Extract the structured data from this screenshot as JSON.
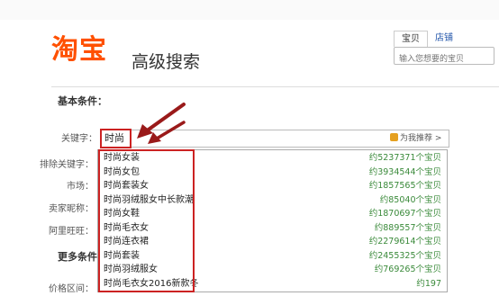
{
  "header": {
    "logo_text": "淘宝",
    "subtitle": "高级搜索",
    "tabs": [
      {
        "label": "宝贝"
      },
      {
        "label": "店铺"
      }
    ],
    "search_placeholder": "输入您想要的宝贝"
  },
  "sections": {
    "basic": "基本条件：",
    "more": "更多条件"
  },
  "fields": {
    "keyword_label": "关键字：",
    "keyword_value": "时尚",
    "help_text": "为我推荐 >",
    "exclude_label": "排除关键字：",
    "market_label": "市场：",
    "seller_label": "卖家昵称：",
    "wangwang_label": "阿里旺旺：",
    "price_label": "价格区间："
  },
  "suggestions": [
    {
      "term": "时尚女装",
      "count": "约5237371个宝贝"
    },
    {
      "term": "时尚女包",
      "count": "约3934544个宝贝"
    },
    {
      "term": "时尚套装女",
      "count": "约1857565个宝贝"
    },
    {
      "term": "时尚羽绒服女中长款潮",
      "count": "约85040个宝贝"
    },
    {
      "term": "时尚女鞋",
      "count": "约1870697个宝贝"
    },
    {
      "term": "时尚毛衣女",
      "count": "约889557个宝贝"
    },
    {
      "term": "时尚连衣裙",
      "count": "约2279614个宝贝"
    },
    {
      "term": "时尚套装",
      "count": "约2455325个宝贝"
    },
    {
      "term": "时尚羽绒服女",
      "count": "约769265个宝贝"
    },
    {
      "term": "时尚毛衣女2016新款冬",
      "count": "约197"
    }
  ],
  "colors": {
    "brand": "#ff5000",
    "annotation": "#cc2222",
    "count_green": "#3a8a3a"
  }
}
